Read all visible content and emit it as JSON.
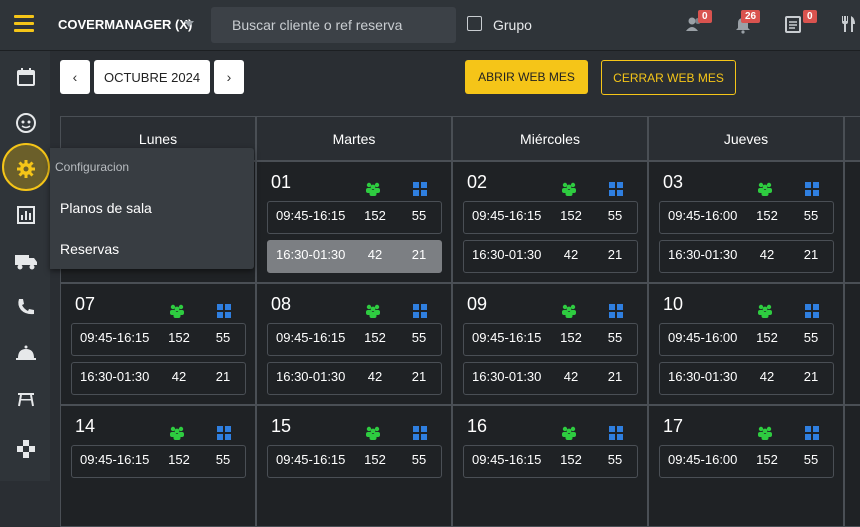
{
  "header": {
    "brand": "COVERMANAGER (X)",
    "search_placeholder": "Buscar cliente o ref reserva",
    "grupo_label": "Grupo",
    "badges": {
      "guests": "0",
      "alerts": "26",
      "tasks": "0"
    }
  },
  "menu": {
    "header": "Configuracion",
    "items": [
      "Planos de sala",
      "Reservas"
    ]
  },
  "toolbar": {
    "prev": "‹",
    "next": "›",
    "month": "OCTUBRE 2024",
    "open_btn": "ABRIR WEB MES",
    "close_btn": "CERRAR WEB MES"
  },
  "calendar": {
    "day_headers": [
      "Lunes",
      "Martes",
      "Miércoles",
      "Jueves"
    ],
    "rows": [
      [
        null,
        {
          "num": "01",
          "shifts": [
            [
              "09:45-16:15",
              "152",
              "55"
            ],
            [
              "16:30-01:30",
              "42",
              "21"
            ]
          ]
        },
        {
          "num": "02",
          "shifts": [
            [
              "09:45-16:15",
              "152",
              "55"
            ],
            [
              "16:30-01:30",
              "42",
              "21"
            ]
          ]
        },
        {
          "num": "03",
          "shifts": [
            [
              "09:45-16:00",
              "152",
              "55"
            ],
            [
              "16:30-01:30",
              "42",
              "21"
            ]
          ]
        }
      ],
      [
        {
          "num": "07",
          "shifts": [
            [
              "09:45-16:15",
              "152",
              "55"
            ],
            [
              "16:30-01:30",
              "42",
              "21"
            ]
          ]
        },
        {
          "num": "08",
          "shifts": [
            [
              "09:45-16:15",
              "152",
              "55"
            ],
            [
              "16:30-01:30",
              "42",
              "21"
            ]
          ]
        },
        {
          "num": "09",
          "shifts": [
            [
              "09:45-16:15",
              "152",
              "55"
            ],
            [
              "16:30-01:30",
              "42",
              "21"
            ]
          ]
        },
        {
          "num": "10",
          "shifts": [
            [
              "09:45-16:00",
              "152",
              "55"
            ],
            [
              "16:30-01:30",
              "42",
              "21"
            ]
          ]
        }
      ],
      [
        {
          "num": "14",
          "shifts": [
            [
              "09:45-16:15",
              "152",
              "55"
            ]
          ]
        },
        {
          "num": "15",
          "shifts": [
            [
              "09:45-16:15",
              "152",
              "55"
            ]
          ]
        },
        {
          "num": "16",
          "shifts": [
            [
              "09:45-16:15",
              "152",
              "55"
            ]
          ]
        },
        {
          "num": "17",
          "shifts": [
            [
              "09:45-16:00",
              "152",
              "55"
            ]
          ]
        }
      ]
    ]
  },
  "colors": {
    "accent": "#f5c518",
    "people_icon": "#2ecc40",
    "grid_icon": "#2f7fe0",
    "badge": "#d9534f"
  }
}
